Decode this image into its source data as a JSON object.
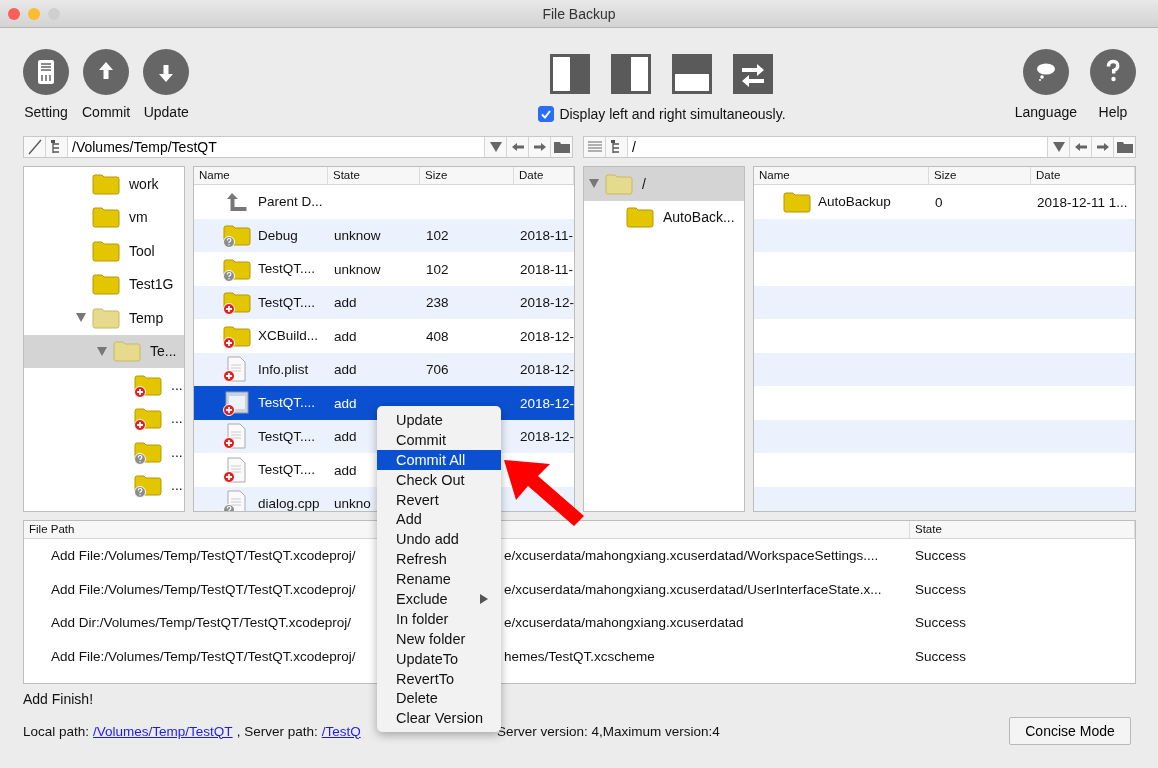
{
  "window": {
    "title": "File Backup"
  },
  "toolbar": {
    "left_buttons": [
      {
        "label": "Setting",
        "kind": "setting"
      },
      {
        "label": "Commit",
        "kind": "up"
      },
      {
        "label": "Update",
        "kind": "down"
      }
    ],
    "layout_buttons": [
      {
        "kind": "left"
      },
      {
        "kind": "right"
      },
      {
        "kind": "bottom"
      },
      {
        "kind": "swap"
      }
    ],
    "display_both": {
      "label": "Display left and right simultaneously.",
      "checked": true
    },
    "right_buttons": [
      {
        "label": "Language",
        "kind": "speech"
      },
      {
        "label": "Help",
        "kind": "help"
      }
    ]
  },
  "left_pane": {
    "path": "/Volumes/Temp/TestQT",
    "tree": [
      {
        "label": "work",
        "kind": "folder",
        "selected": false
      },
      {
        "label": "vm",
        "kind": "folder",
        "selected": false
      },
      {
        "label": "Tool",
        "kind": "folder",
        "selected": false
      },
      {
        "label": "Test1G",
        "kind": "folder",
        "selected": false
      },
      {
        "label": "Temp",
        "kind": "folder",
        "selected": false,
        "expanded": true,
        "children": [
          {
            "label": "Te...",
            "kind": "folder",
            "selected": true,
            "expanded": true,
            "children": [
              {
                "label": "...",
                "kind": "folderadd",
                "selected": false
              },
              {
                "label": "...",
                "kind": "folderadd",
                "selected": false
              },
              {
                "label": "...",
                "kind": "folderunknown",
                "selected": false
              },
              {
                "label": "...",
                "kind": "folderunknown",
                "selected": false
              }
            ]
          }
        ]
      }
    ],
    "table": {
      "columns": [
        "Name",
        "State",
        "Size",
        "Date"
      ],
      "rows": [
        {
          "kind": "parent",
          "name": "Parent D...",
          "selected": false
        },
        {
          "kind": "folderunknown",
          "name": "Debug",
          "state": "unknow",
          "size": "102",
          "date": "2018-11-",
          "selected": false
        },
        {
          "kind": "folderunknown",
          "name": "TestQT....",
          "state": "unknow",
          "size": "102",
          "date": "2018-11-",
          "selected": false
        },
        {
          "kind": "folderadd",
          "name": "TestQT....",
          "state": "add",
          "size": "238",
          "date": "2018-12-",
          "selected": false
        },
        {
          "kind": "folderadd",
          "name": "XCBuild...",
          "state": "add",
          "size": "408",
          "date": "2018-12-",
          "selected": false
        },
        {
          "kind": "documentadd",
          "name": "Info.plist",
          "state": "add",
          "size": "706",
          "date": "2018-12-",
          "selected": false
        },
        {
          "kind": "windowadd",
          "name": "TestQT....",
          "state": "add",
          "date": "2018-12-",
          "selected": true
        },
        {
          "kind": "documentadd",
          "name": "TestQT....",
          "state": "add",
          "date": "2018-12-",
          "selected": false
        },
        {
          "kind": "documentadd",
          "name": "TestQT....",
          "state": "add",
          "selected": false
        },
        {
          "kind": "documentunknown",
          "name": "dialog.cpp",
          "state": "unkno",
          "selected": false
        }
      ]
    }
  },
  "right_pane": {
    "path": "/",
    "tree": [
      {
        "label": "/",
        "kind": "folder",
        "selected": true,
        "expanded": true,
        "children": [
          {
            "label": "AutoBack...",
            "kind": "folder",
            "selected": false
          }
        ]
      }
    ],
    "table": {
      "columns": [
        "Name",
        "Size",
        "Date"
      ],
      "rows": [
        {
          "kind": "folder",
          "name": "AutoBackup",
          "size": "0",
          "date": "2018-12-11 1...",
          "selected": false
        }
      ]
    }
  },
  "log": {
    "columns": [
      "File Path",
      "State"
    ],
    "rows": [
      {
        "path_start": "Add File:/Volumes/Temp/TestQT/TestQT.xcodeproj/",
        "path_end": "e/xcuserdata/mahongxiang.xcuserdatad/WorkspaceSettings....",
        "state": "Success"
      },
      {
        "path_start": "Add File:/Volumes/Temp/TestQT/TestQT.xcodeproj/",
        "path_end": "e/xcuserdata/mahongxiang.xcuserdatad/UserInterfaceState.x...",
        "state": "Success"
      },
      {
        "path_start": "Add Dir:/Volumes/Temp/TestQT/TestQT.xcodeproj/",
        "path_end": "e/xcuserdata/mahongxiang.xcuserdatad",
        "state": "Success"
      },
      {
        "path_start": "Add File:/Volumes/Temp/TestQT/TestQT.xcodeproj/",
        "path_end": "hemes/TestQT.xcscheme",
        "state": "Success"
      }
    ]
  },
  "message": "Add Finish!",
  "status": {
    "local_label": "Local path:",
    "local_link": "/Volumes/Temp/TestQT",
    "server_label": ", Server path:",
    "server_link": "/TestQ",
    "version": "Server version: 4,Maximum version:4"
  },
  "mode_button": "Concise Mode",
  "context_menu": {
    "items": [
      {
        "label": "Update",
        "selected": false
      },
      {
        "label": "Commit",
        "selected": false
      },
      {
        "label": "Commit All",
        "selected": true
      },
      {
        "label": "Check Out",
        "selected": false
      },
      {
        "label": "Revert",
        "selected": false
      },
      {
        "label": "Add",
        "selected": false
      },
      {
        "label": "Undo add",
        "selected": false
      },
      {
        "label": "Refresh",
        "selected": false
      },
      {
        "label": "Rename",
        "selected": false
      },
      {
        "label": "Exclude",
        "selected": false,
        "submenu": true
      },
      {
        "label": "In folder",
        "selected": false
      },
      {
        "label": "New folder",
        "selected": false
      },
      {
        "label": "UpdateTo",
        "selected": false
      },
      {
        "label": "RevertTo",
        "selected": false
      },
      {
        "label": "Delete",
        "selected": false
      },
      {
        "label": "Clear Version",
        "selected": false
      }
    ]
  }
}
